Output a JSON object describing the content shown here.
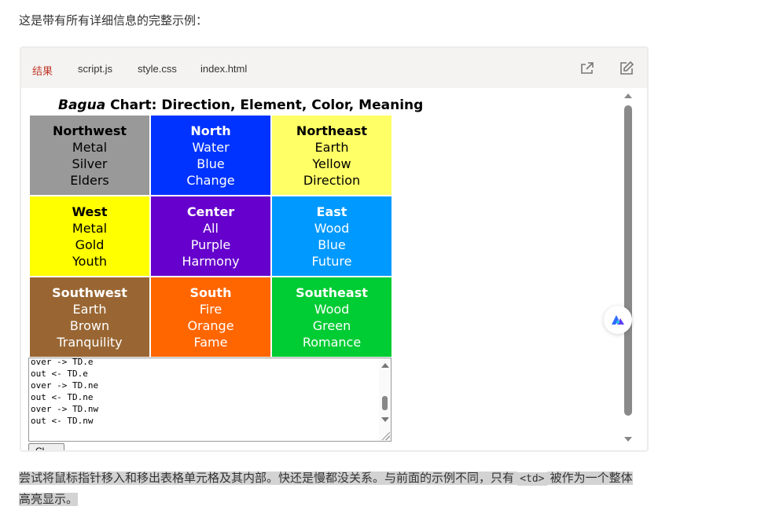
{
  "intro": "这是带有所有详细信息的完整示例：",
  "tabs": [
    {
      "label": "结果",
      "active": true
    },
    {
      "label": "script.js",
      "active": false
    },
    {
      "label": "style.css",
      "active": false
    },
    {
      "label": "index.html",
      "active": false
    }
  ],
  "toolbar_icons": [
    "share-icon",
    "edit-icon"
  ],
  "chart": {
    "title_italic": "Bagua",
    "title_rest": " Chart: Direction, Element, Color, Meaning",
    "rows": [
      [
        {
          "direction": "Northwest",
          "element": "Metal",
          "color": "Silver",
          "meaning": "Elders",
          "bg": "#999999",
          "fg": "#000000"
        },
        {
          "direction": "North",
          "element": "Water",
          "color": "Blue",
          "meaning": "Change",
          "bg": "#0033ff",
          "fg": "#ffffff"
        },
        {
          "direction": "Northeast",
          "element": "Earth",
          "color": "Yellow",
          "meaning": "Direction",
          "bg": "#ffff66",
          "fg": "#000000"
        }
      ],
      [
        {
          "direction": "West",
          "element": "Metal",
          "color": "Gold",
          "meaning": "Youth",
          "bg": "#ffff00",
          "fg": "#000000"
        },
        {
          "direction": "Center",
          "element": "All",
          "color": "Purple",
          "meaning": "Harmony",
          "bg": "#6600cc",
          "fg": "#ffffff"
        },
        {
          "direction": "East",
          "element": "Wood",
          "color": "Blue",
          "meaning": "Future",
          "bg": "#0099ff",
          "fg": "#ffffff"
        }
      ],
      [
        {
          "direction": "Southwest",
          "element": "Earth",
          "color": "Brown",
          "meaning": "Tranquility",
          "bg": "#996633",
          "fg": "#ffffff"
        },
        {
          "direction": "South",
          "element": "Fire",
          "color": "Orange",
          "meaning": "Fame",
          "bg": "#ff6600",
          "fg": "#ffffff"
        },
        {
          "direction": "Southeast",
          "element": "Wood",
          "color": "Green",
          "meaning": "Romance",
          "bg": "#00cc33",
          "fg": "#ffffff"
        }
      ]
    ]
  },
  "log_lines": [
    "over -> TD.e",
    "out <- TD.e",
    "over -> TD.ne",
    "out <- TD.ne",
    "over -> TD.nw",
    "out <- TD.nw"
  ],
  "clear_button": "Cl",
  "description": {
    "part1": "尝试将鼠标指针移入和移出表格单元格及其内部。快还是慢都没关系。与前面的示例不同，只有 ",
    "code": "<td>",
    "part2": " 被作为一个整体高亮显示。"
  }
}
